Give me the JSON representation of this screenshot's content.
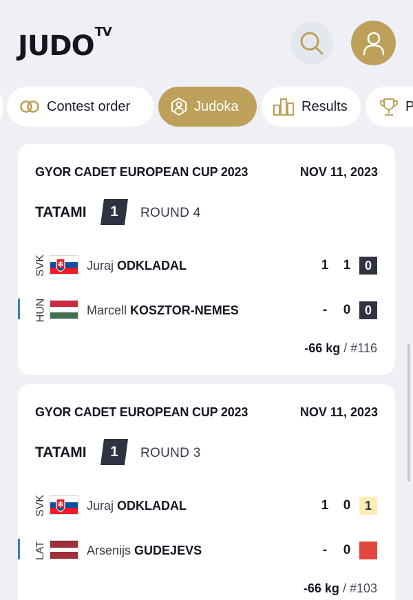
{
  "header": {
    "logo_main": "JUDO",
    "logo_sup": "TV",
    "colors": {
      "accent": "#bda15a",
      "background": "#eef0f6"
    }
  },
  "tabs": [
    {
      "label": "",
      "icon": "partial-tab"
    },
    {
      "label": "Contest order",
      "icon": "rings-icon"
    },
    {
      "label": "Judoka",
      "icon": "judoka-icon",
      "active": true
    },
    {
      "label": "Results",
      "icon": "bars-icon"
    },
    {
      "label": "P",
      "icon": "trophy-icon"
    }
  ],
  "contests": [
    {
      "event": "GYOR CADET EUROPEAN CUP 2023",
      "date": "NOV 11, 2023",
      "tatami_label": "TATAMI",
      "tatami_number": "1",
      "round": "ROUND 4",
      "fighters": [
        {
          "country": "SVK",
          "flag": "slovakia",
          "first": "Juraj",
          "last": "ODKLADAL",
          "score1": "1",
          "score2": "1",
          "shido": "0",
          "shido_style": "dark"
        },
        {
          "country": "HUN",
          "flag": "hungary",
          "first": "Marcell",
          "last": "KOSZTOR-NEMES",
          "score1": "-",
          "score2": "0",
          "shido": "0",
          "shido_style": "dark"
        }
      ],
      "weight": "-66 kg",
      "contest_no": "/ #116"
    },
    {
      "event": "GYOR CADET EUROPEAN CUP 2023",
      "date": "NOV 11, 2023",
      "tatami_label": "TATAMI",
      "tatami_number": "1",
      "round": "ROUND 3",
      "fighters": [
        {
          "country": "SVK",
          "flag": "slovakia",
          "first": "Juraj",
          "last": "ODKLADAL",
          "score1": "1",
          "score2": "0",
          "shido": "1",
          "shido_style": "yellow"
        },
        {
          "country": "LAT",
          "flag": "latvia",
          "first": "Arsenijs",
          "last": "GUDEJEVS",
          "score1": "-",
          "score2": "0",
          "shido": "",
          "shido_style": "red"
        }
      ],
      "weight": "-66 kg",
      "contest_no": "/ #103"
    }
  ]
}
